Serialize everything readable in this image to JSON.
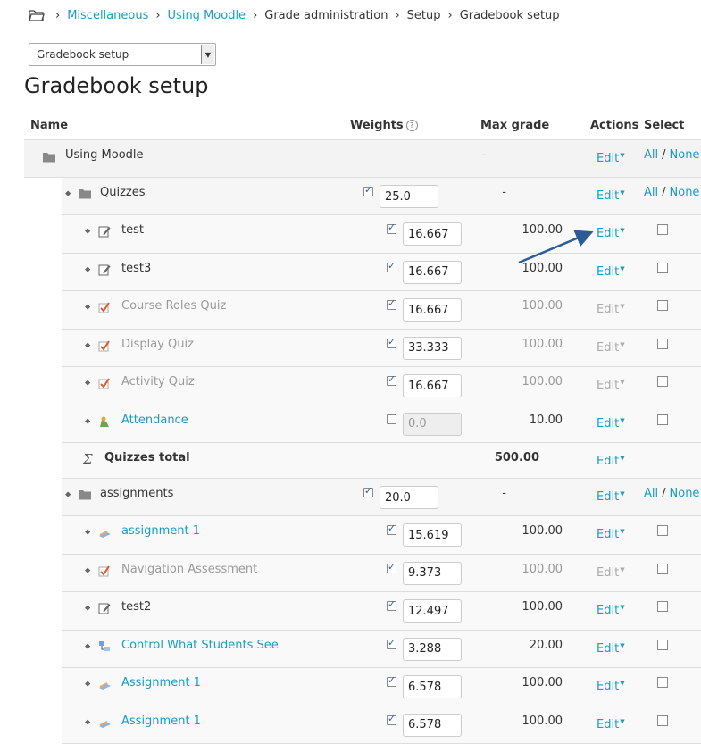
{
  "breadcrumb": [
    "Miscellaneous",
    "Using Moodle",
    "Grade administration",
    "Setup",
    "Gradebook setup"
  ],
  "jump_select": {
    "value": "Gradebook setup"
  },
  "page_title": "Gradebook setup",
  "headers": {
    "name": "Name",
    "weights": "Weights",
    "max_grade": "Max grade",
    "actions": "Actions",
    "select": "Select"
  },
  "edit_label": "Edit",
  "select_all": "All",
  "select_none": "None",
  "select_sep": "/",
  "course": {
    "name": "Using Moodle",
    "max_grade": "-"
  },
  "categories": [
    {
      "name": "Quizzes",
      "weight": "25.0",
      "max_grade": "-",
      "items": [
        {
          "name": "test",
          "weight": "16.667",
          "max_grade": "100.00",
          "icon": "assignment-edit-icon",
          "link": false,
          "dimmed": false
        },
        {
          "name": "test3",
          "weight": "16.667",
          "max_grade": "100.00",
          "icon": "assignment-edit-icon",
          "link": false,
          "dimmed": false
        },
        {
          "name": "Course Roles Quiz",
          "weight": "16.667",
          "max_grade": "100.00",
          "icon": "quiz-icon",
          "link": false,
          "dimmed": true
        },
        {
          "name": "Display Quiz",
          "weight": "33.333",
          "max_grade": "100.00",
          "icon": "quiz-icon",
          "link": false,
          "dimmed": true
        },
        {
          "name": "Activity Quiz",
          "weight": "16.667",
          "max_grade": "100.00",
          "icon": "quiz-icon",
          "link": false,
          "dimmed": true
        },
        {
          "name": "Attendance",
          "weight": "0.0",
          "max_grade": "10.00",
          "icon": "attendance-icon",
          "link": true,
          "dimmed": false,
          "unchecked": true
        }
      ],
      "total": {
        "name": "Quizzes total",
        "max_grade": "500.00"
      }
    },
    {
      "name": "assignments",
      "weight": "20.0",
      "max_grade": "-",
      "items": [
        {
          "name": "assignment 1",
          "weight": "15.619",
          "max_grade": "100.00",
          "icon": "assignment-icon",
          "link": true,
          "dimmed": false
        },
        {
          "name": "Navigation Assessment",
          "weight": "9.373",
          "max_grade": "100.00",
          "icon": "quiz-icon",
          "link": false,
          "dimmed": true
        },
        {
          "name": "test2",
          "weight": "12.497",
          "max_grade": "100.00",
          "icon": "assignment-edit-icon",
          "link": false,
          "dimmed": false
        },
        {
          "name": "Control What Students See",
          "weight": "3.288",
          "max_grade": "20.00",
          "icon": "lesson-icon",
          "link": true,
          "dimmed": false
        },
        {
          "name": "Assignment 1",
          "weight": "6.578",
          "max_grade": "100.00",
          "icon": "assignment-icon",
          "link": true,
          "dimmed": false
        },
        {
          "name": "Assignment 1",
          "weight": "6.578",
          "max_grade": "100.00",
          "icon": "assignment-icon",
          "link": true,
          "dimmed": false
        }
      ]
    }
  ],
  "colors": {
    "link": "#1a9cc4",
    "arrow": "#2c5c96"
  }
}
